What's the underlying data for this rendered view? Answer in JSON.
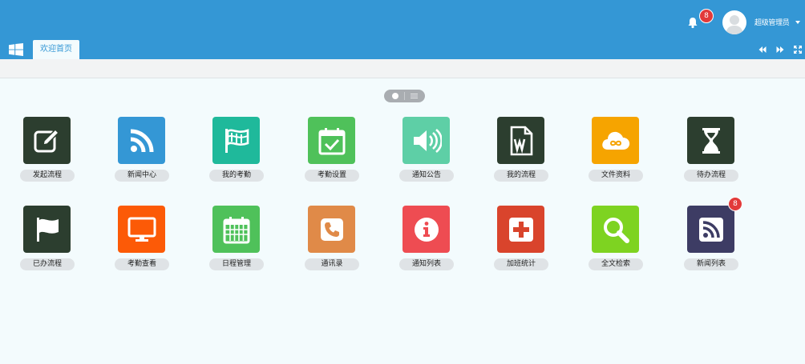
{
  "header": {
    "notification_count": "8",
    "username": "超级管理员",
    "bell_icon": "bell-icon",
    "avatar_icon": "user-avatar"
  },
  "tabs": [
    {
      "label": "欢迎首页",
      "active": true
    }
  ],
  "colors": {
    "topbar": "#3497d5",
    "page_bg": "#f3fbfd",
    "badge": "#e23a3a"
  },
  "apps": [
    {
      "label": "发起流程",
      "icon": "edit-icon",
      "color": "#2c3e2f"
    },
    {
      "label": "新闻中心",
      "icon": "rss-icon",
      "color": "#3497d5"
    },
    {
      "label": "我的考勤",
      "icon": "flag-icon",
      "color": "#1fb99b"
    },
    {
      "label": "考勤设置",
      "icon": "calendar-check-icon",
      "color": "#4fc15a"
    },
    {
      "label": "通知公告",
      "icon": "volume-icon",
      "color": "#5ecfa6"
    },
    {
      "label": "我的流程",
      "icon": "word-file-icon",
      "color": "#2c3e2f"
    },
    {
      "label": "文件资料",
      "icon": "cloud-icon",
      "color": "#f6a400"
    },
    {
      "label": "待办流程",
      "icon": "hourglass-icon",
      "color": "#2c3e2f"
    },
    {
      "label": "已办流程",
      "icon": "flag-outline-icon",
      "color": "#2c3e2f"
    },
    {
      "label": "考勤查看",
      "icon": "monitor-icon",
      "color": "#fc5a07"
    },
    {
      "label": "日程管理",
      "icon": "calendar-icon",
      "color": "#4fc15a"
    },
    {
      "label": "通讯录",
      "icon": "phone-icon",
      "color": "#e08a48"
    },
    {
      "label": "通知列表",
      "icon": "info-icon",
      "color": "#ee4c52"
    },
    {
      "label": "加班统计",
      "icon": "plus-square-icon",
      "color": "#d9442c"
    },
    {
      "label": "全文检索",
      "icon": "search-icon",
      "color": "#7ed321"
    },
    {
      "label": "新闻列表",
      "icon": "rss-square-icon",
      "color": "#3d3c64",
      "badge": "8"
    }
  ]
}
